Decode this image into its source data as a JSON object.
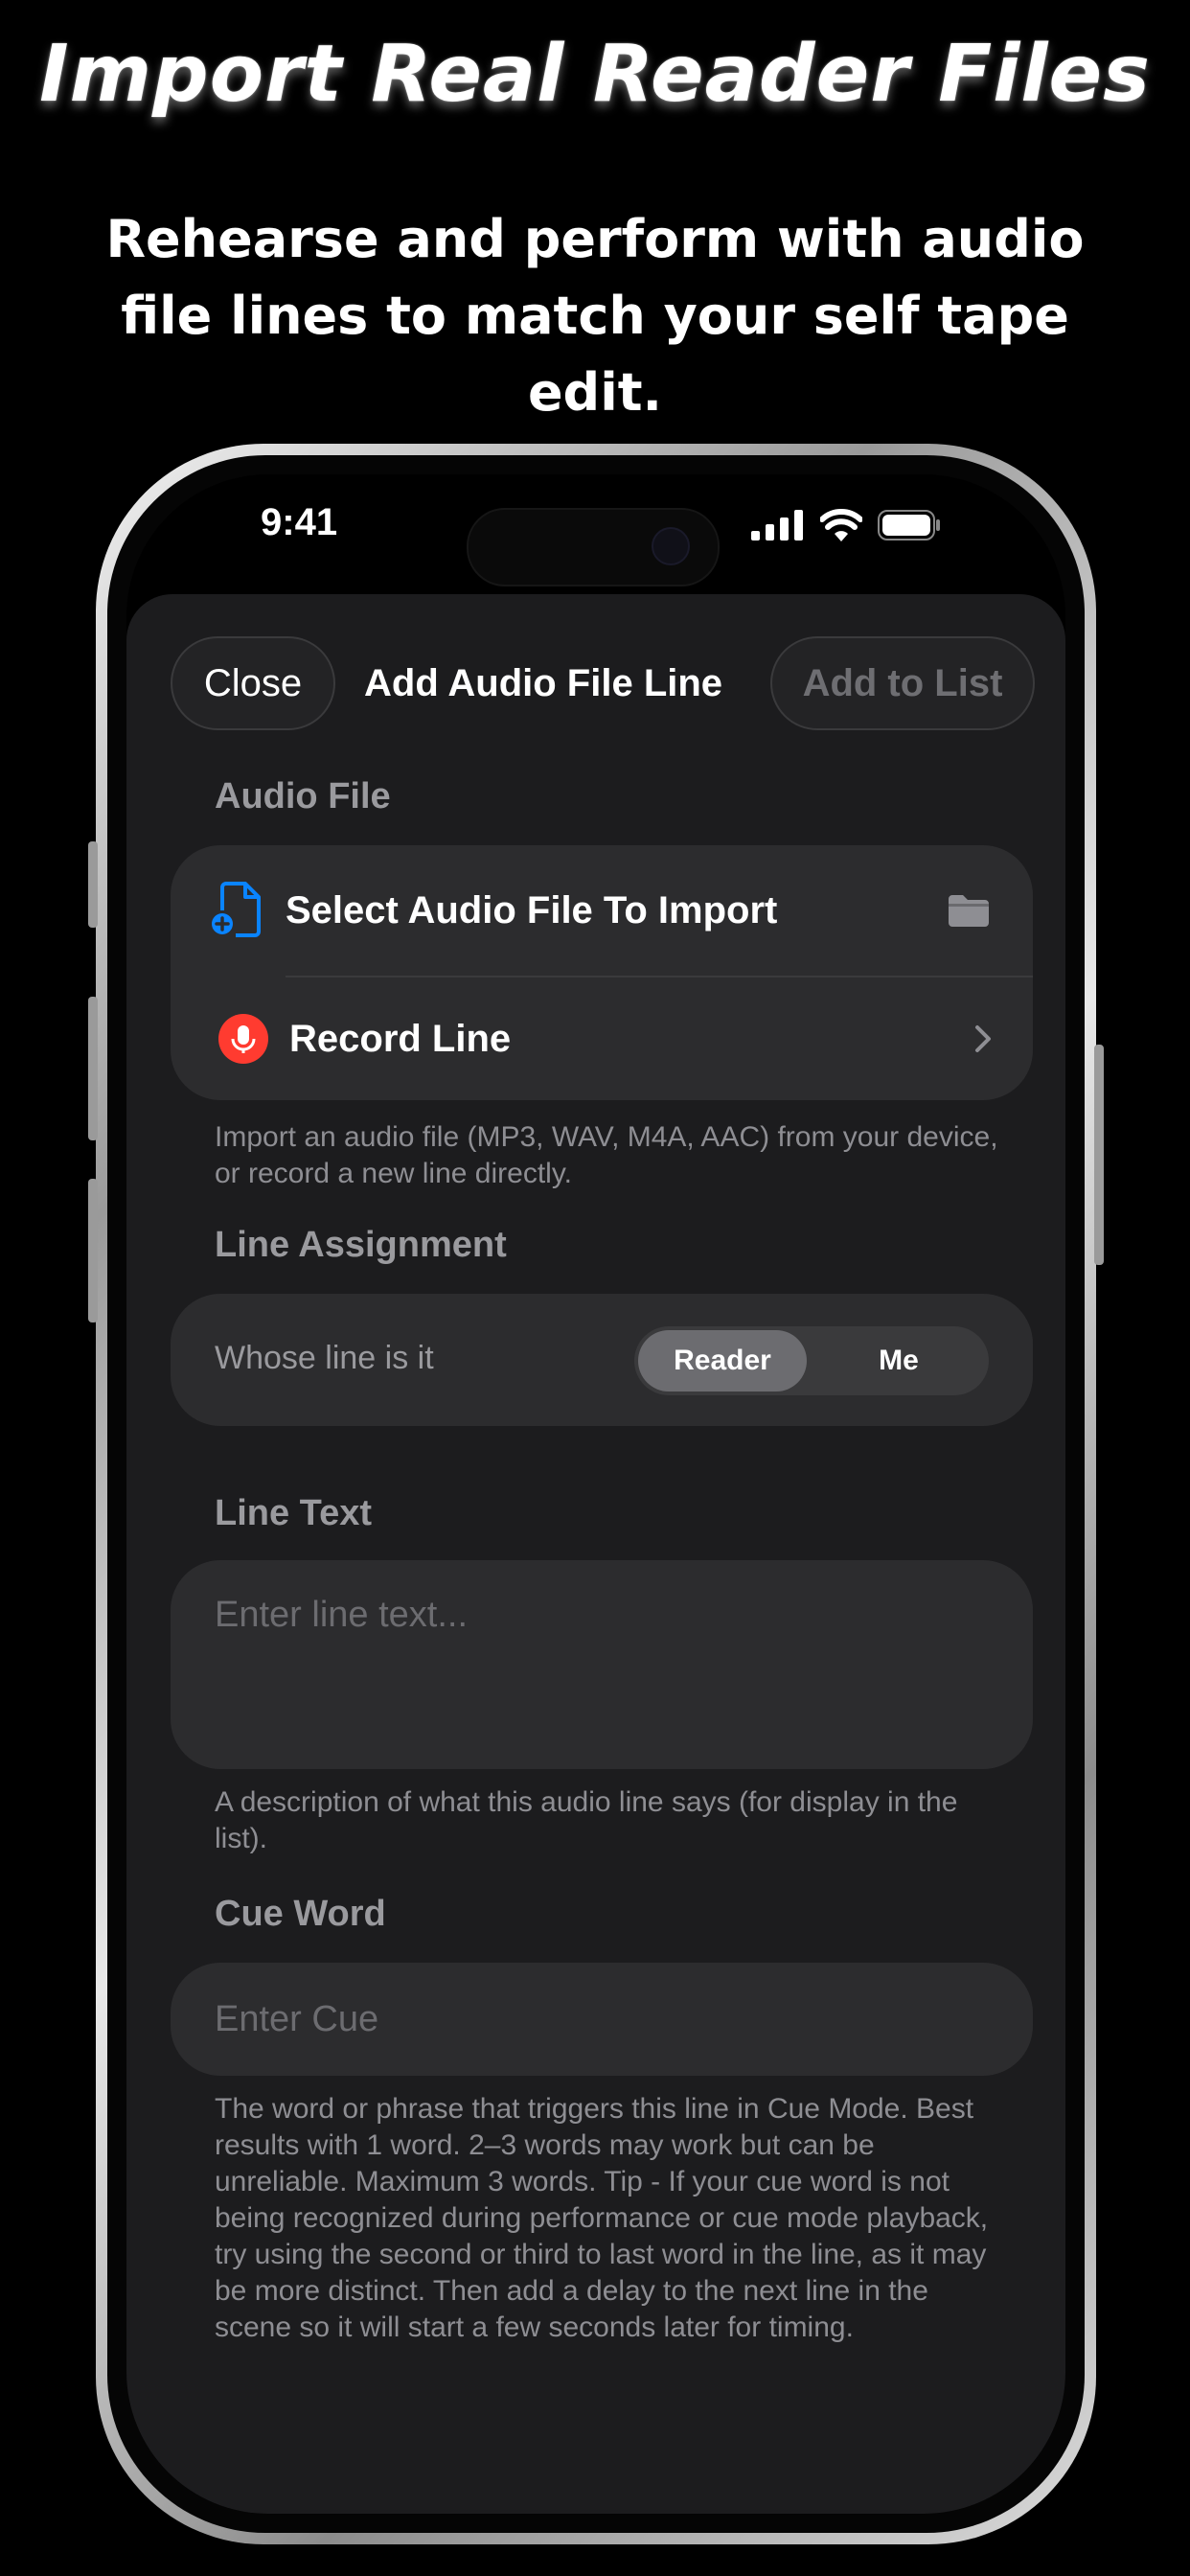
{
  "marketing": {
    "headline": "Import Real Reader Files",
    "subhead": "Rehearse and perform with audio file lines to match your self tape edit."
  },
  "status_bar": {
    "time": "9:41"
  },
  "nav": {
    "close_label": "Close",
    "title": "Add Audio File Line",
    "add_label": "Add to List"
  },
  "audio_file": {
    "section_title": "Audio File",
    "select_label": "Select Audio File To Import",
    "record_label": "Record Line",
    "footnote": "Import an audio file (MP3, WAV, M4A, AAC) from your device, or record a new line directly."
  },
  "line_assignment": {
    "section_title": "Line Assignment",
    "question": "Whose line is it",
    "options": [
      "Reader",
      "Me"
    ],
    "selected": "Reader"
  },
  "line_text": {
    "section_title": "Line Text",
    "placeholder": "Enter line text...",
    "footnote": "A description of what this audio line says (for display in the list)."
  },
  "cue_word": {
    "section_title": "Cue Word",
    "placeholder": "Enter Cue",
    "footnote": "The word or phrase that triggers this line in Cue Mode. Best results with 1 word. 2–3 words may work but can be unreliable. Maximum 3 words. Tip - If your cue word is not being recognized during performance or cue mode playback, try using the second or third to last word in the line, as it may be more distinct. Then add a delay to the next line in the scene so it will start a few seconds later for timing."
  },
  "colors": {
    "background": "#000000",
    "sheet": "#1c1c1e",
    "card": "#2c2c2e",
    "accent_blue": "#0a84ff",
    "record_red": "#ff3b30",
    "secondary_text": "#8e8e93"
  },
  "icons": [
    "signal-icon",
    "wifi-icon",
    "battery-icon",
    "document-add-icon",
    "folder-icon",
    "microphone-icon",
    "chevron-right-icon"
  ]
}
